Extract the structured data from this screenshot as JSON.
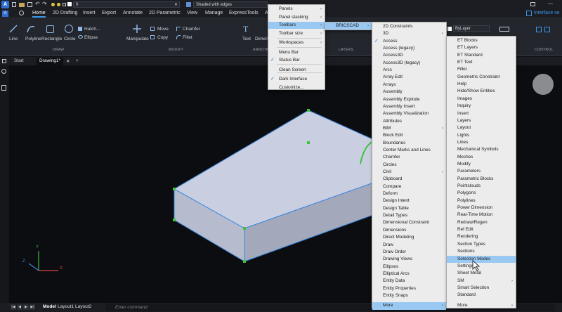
{
  "quick_access": {
    "layer_value": "0",
    "visual_style": "Shaded with edges"
  },
  "ribbon_tabs": [
    "Home",
    "2D Drafting",
    "Insert",
    "Export",
    "Annotate",
    "2D Parametric",
    "View",
    "Manage",
    "ExpressTools",
    "A"
  ],
  "interface_label": "Interface se",
  "ribbon": {
    "draw": {
      "line": "Line",
      "polyline": "Polyline",
      "rectangle": "Rectangle",
      "circle": "Circle",
      "hatch": "Hatch...",
      "ellipse": "Ellipse",
      "group": "DRAW"
    },
    "modify": {
      "manipulate": "Manipulate",
      "move": "Move",
      "copy": "Copy",
      "chamfer": "Chamfer",
      "fillet": "Fillet",
      "group": "MODIFY"
    },
    "annotate": {
      "text": "Text",
      "dimension": "Dimen",
      "group": "ANNOTAT"
    },
    "layers": {
      "group": "LAYERS"
    },
    "properties": {
      "bylayer": "ByLayer"
    },
    "control": {
      "group": "CONTROL"
    }
  },
  "doc_tabs": [
    "Start",
    "Drawing1*"
  ],
  "command": {
    "placeholder": "Enter command"
  },
  "layout_tabs": [
    "Model",
    "Layout1",
    "Layout2"
  ],
  "menu1": {
    "items": [
      {
        "label": "Panels",
        "arrow": true
      },
      {
        "label": "Panel stacking",
        "arrow": true
      },
      {
        "label": "Toolbars",
        "arrow": true,
        "highlight": true
      },
      {
        "label": "Toolbar size",
        "arrow": true
      },
      {
        "label": "Workspaces",
        "arrow": true
      },
      {
        "label": "Menu Bar"
      },
      {
        "label": "Status Bar",
        "checked": true
      },
      {
        "label": "Clean Screen"
      },
      {
        "label": "Dark Interface",
        "checked": true
      },
      {
        "label": "Customize..."
      }
    ]
  },
  "menu2": {
    "items": [
      {
        "label": "BRICSCAD",
        "arrow": true,
        "highlight": true
      }
    ]
  },
  "menu3": {
    "items": [
      "2D Constraints",
      "3D",
      "Access",
      "Access (legacy)",
      "Access3D",
      "Access3D (legacy)",
      "Arcs",
      "Array Edit",
      "Arrays",
      "Assembly",
      "Assembly Explode",
      "Assembly Insert",
      "Assembly Visualization",
      "Attributes",
      "BIM",
      "Block Edit",
      "Boundaries",
      "Center Marks and Lines",
      "Chamfer",
      "Circles",
      "Civil",
      "Clipboard",
      "Compare",
      "Deform",
      "Design Intent",
      "Design Table",
      "Detail Types",
      "Dimensional Constraint",
      "Dimensions",
      "Direct Modeling",
      "Draw",
      "Draw Order",
      "Drawing Views",
      "Ellipses",
      "Elliptical Arcs",
      "Entity Data",
      "Entity Properties",
      "Entity Snaps",
      "More"
    ],
    "arrows": [
      "3D",
      "BIM",
      "Civil",
      "More"
    ],
    "checked": [
      "Access"
    ],
    "highlight": "More"
  },
  "menu4": {
    "items": [
      "ET Blocks",
      "ET Layers",
      "ET Standard",
      "ET Text",
      "Fillet",
      "Geometric Constraint",
      "Help",
      "Hide/Show Entities",
      "Images",
      "Inquiry",
      "Insert",
      "Layers",
      "Layout",
      "Lights",
      "Lines",
      "Mechanical Symbols",
      "Meshes",
      "Modify",
      "Parameters",
      "Parametric Blocks",
      "Pointclouds",
      "Polygons",
      "Polylines",
      "Power Dimension",
      "Real-Time Motion",
      "Redraw/Regen",
      "Ref Edit",
      "Rendering",
      "Section Types",
      "Sections",
      "Selection Modes",
      "Settings",
      "Sheet Metal",
      "SM",
      "Smart Selection",
      "Standard",
      "More"
    ],
    "arrows": [
      "SM",
      "More"
    ],
    "highlight": "Selection Modes"
  },
  "colors": {
    "accent": "#3b95e8",
    "menu_highlight": "#99c9f3",
    "selection_blue": "#3a86e0",
    "grip_green": "#3ec23e"
  },
  "ucs": {
    "x": "X",
    "y": "Y",
    "z": "Z"
  }
}
